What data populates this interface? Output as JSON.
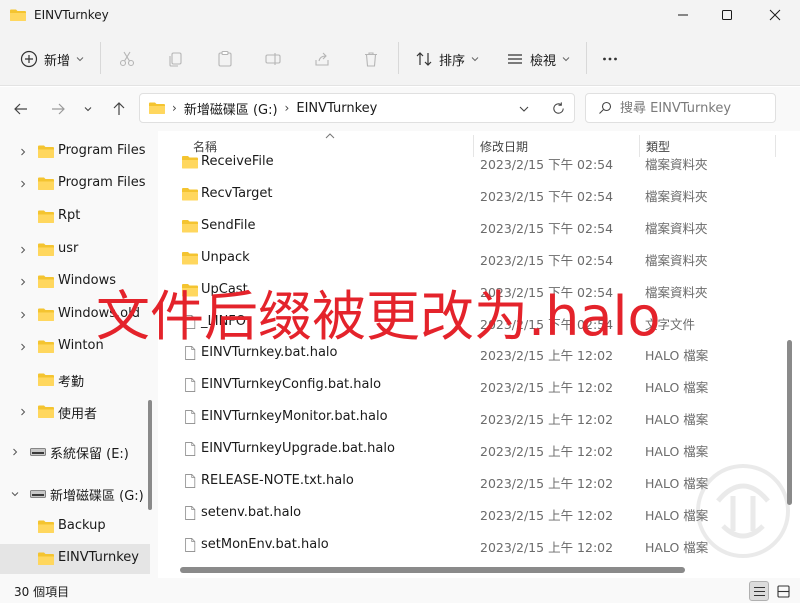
{
  "window": {
    "title": "EINVTurnkey"
  },
  "commandbar": {
    "new_label": "新增",
    "sort_label": "排序",
    "view_label": "檢視"
  },
  "address": {
    "crumbs": [
      "新增磁碟區 (G:)",
      "EINVTurnkey"
    ],
    "search_placeholder": "搜尋 EINVTurnkey"
  },
  "navpane": {
    "items": [
      {
        "label": "Program Files",
        "type": "folder",
        "expandable": true
      },
      {
        "label": "Program Files",
        "type": "folder",
        "expandable": true
      },
      {
        "label": "Rpt",
        "type": "folder",
        "expandable": false
      },
      {
        "label": "usr",
        "type": "folder",
        "expandable": true
      },
      {
        "label": "Windows",
        "type": "folder",
        "expandable": true
      },
      {
        "label": "Windows.old",
        "type": "folder",
        "expandable": true
      },
      {
        "label": "Winton",
        "type": "folder",
        "expandable": true
      },
      {
        "label": "考勤",
        "type": "folder",
        "expandable": false
      },
      {
        "label": "使用者",
        "type": "folder",
        "expandable": true
      },
      {
        "label": "系統保留 (E:)",
        "type": "drive",
        "expandable": true
      },
      {
        "label": "新增磁碟區 (G:)",
        "type": "drive",
        "expandable": true,
        "expanded": true
      },
      {
        "label": "Backup",
        "type": "folder",
        "expandable": false
      },
      {
        "label": "EINVTurnkey",
        "type": "folder",
        "expandable": false,
        "selected": true
      }
    ]
  },
  "columns": {
    "name": "名稱",
    "date": "修改日期",
    "type": "類型"
  },
  "files": [
    {
      "name": "ReceiveFile",
      "date": "2023/2/15 下午 02:54",
      "type": "檔案資料夾",
      "kind": "folder"
    },
    {
      "name": "RecvTarget",
      "date": "2023/2/15 下午 02:54",
      "type": "檔案資料夾",
      "kind": "folder"
    },
    {
      "name": "SendFile",
      "date": "2023/2/15 下午 02:54",
      "type": "檔案資料夾",
      "kind": "folder"
    },
    {
      "name": "Unpack",
      "date": "2023/2/15 下午 02:54",
      "type": "檔案資料夾",
      "kind": "folder"
    },
    {
      "name": "UpCast",
      "date": "2023/2/15 下午 02:54",
      "type": "檔案資料夾",
      "kind": "folder"
    },
    {
      "name": "_LINFO",
      "date": "2023/2/15 下午 02:54",
      "type": "文字文件",
      "kind": "file"
    },
    {
      "name": "EINVTurnkey.bat.halo",
      "date": "2023/2/15 上午 12:02",
      "type": "HALO 檔案",
      "kind": "file"
    },
    {
      "name": "EINVTurnkeyConfig.bat.halo",
      "date": "2023/2/15 上午 12:02",
      "type": "HALO 檔案",
      "kind": "file"
    },
    {
      "name": "EINVTurnkeyMonitor.bat.halo",
      "date": "2023/2/15 上午 12:02",
      "type": "HALO 檔案",
      "kind": "file"
    },
    {
      "name": "EINVTurnkeyUpgrade.bat.halo",
      "date": "2023/2/15 上午 12:02",
      "type": "HALO 檔案",
      "kind": "file"
    },
    {
      "name": "RELEASE-NOTE.txt.halo",
      "date": "2023/2/15 上午 12:02",
      "type": "HALO 檔案",
      "kind": "file"
    },
    {
      "name": "setenv.bat.halo",
      "date": "2023/2/15 上午 12:02",
      "type": "HALO 檔案",
      "kind": "file"
    },
    {
      "name": "setMonEnv.bat.halo",
      "date": "2023/2/15 上午 12:02",
      "type": "HALO 檔案",
      "kind": "file"
    }
  ],
  "status": {
    "item_count": "30 個項目"
  },
  "overlay": {
    "caption": "文件后缀被更改为.halo"
  },
  "colors": {
    "folder_yellow": "#f4c430",
    "overlay_red": "#e4232b",
    "accent": "#005fb8"
  }
}
